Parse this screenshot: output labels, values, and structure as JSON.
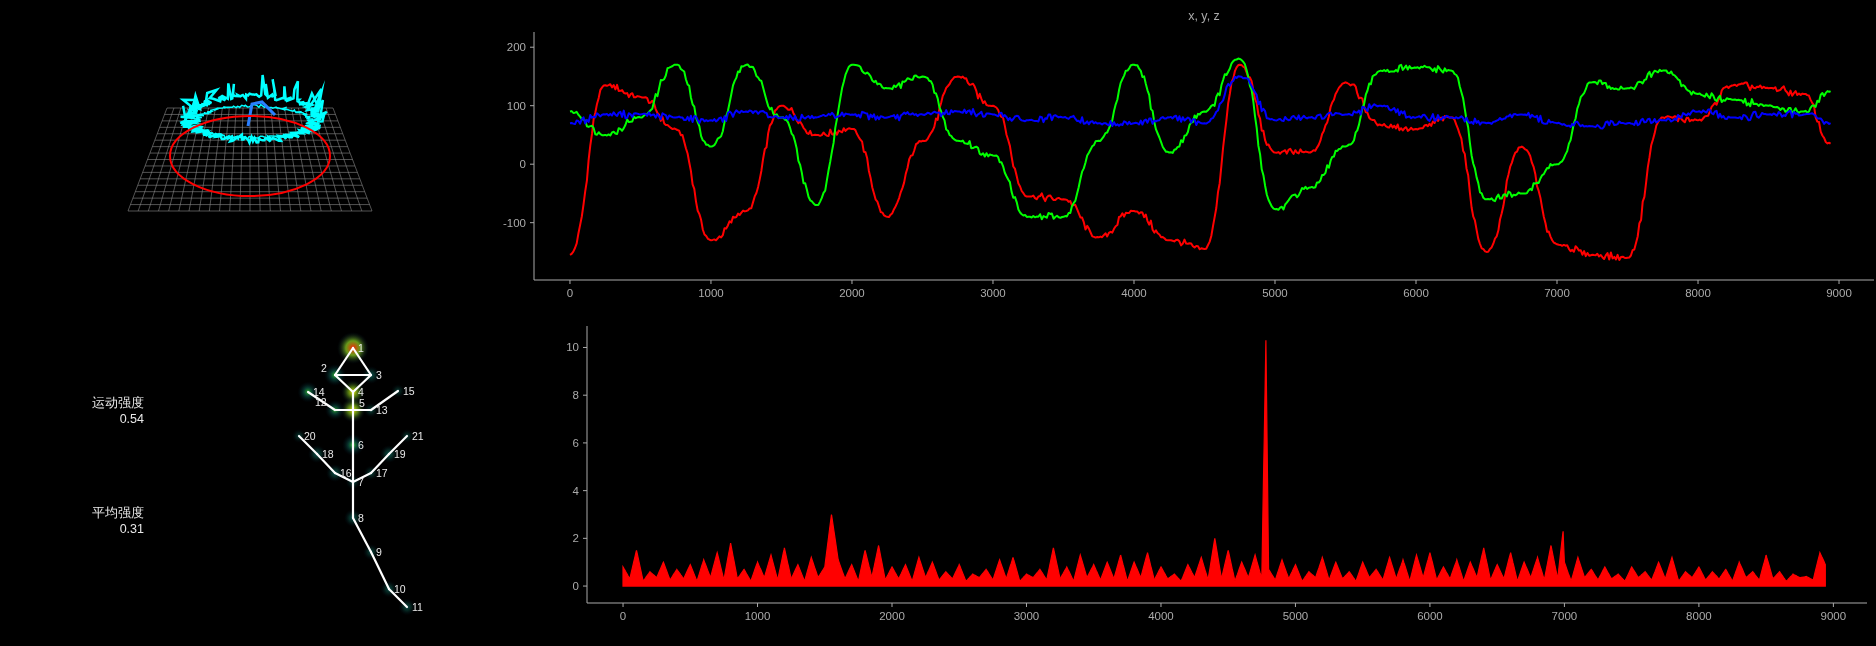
{
  "metrics": [
    {
      "label": "运动强度",
      "value": "0.54"
    },
    {
      "label": "平均强度",
      "value": "0.31"
    }
  ],
  "skeleton": {
    "joints": [
      {
        "label": "1"
      },
      {
        "label": "2"
      },
      {
        "label": "3"
      },
      {
        "label": "4"
      },
      {
        "label": "5"
      },
      {
        "label": "6"
      },
      {
        "label": "7"
      },
      {
        "label": "8"
      },
      {
        "label": "9"
      },
      {
        "label": "10"
      },
      {
        "label": "11"
      },
      {
        "label": "12"
      },
      {
        "label": "13"
      },
      {
        "label": "14"
      },
      {
        "label": "15"
      },
      {
        "label": "16"
      },
      {
        "label": "17"
      },
      {
        "label": "18"
      },
      {
        "label": "19"
      },
      {
        "label": "20"
      },
      {
        "label": "21"
      }
    ]
  },
  "position_chart": {
    "chart_data": {
      "type": "line",
      "title": "x, y, z",
      "x": [
        0,
        250,
        500,
        750,
        1000,
        1250,
        1500,
        1750,
        2000,
        2250,
        2500,
        2750,
        3000,
        3250,
        3500,
        3750,
        4000,
        4250,
        4500,
        4750,
        5000,
        5250,
        5500,
        5750,
        6000,
        6250,
        6500,
        6750,
        7000,
        7250,
        7500,
        7750,
        8000,
        8250,
        8500,
        8750,
        8940
      ],
      "series": [
        {
          "color": "#ff0000",
          "values": [
            -155,
            135,
            115,
            60,
            -130,
            -80,
            100,
            50,
            60,
            -90,
            40,
            150,
            100,
            -55,
            -60,
            -125,
            -80,
            -130,
            -145,
            170,
            20,
            20,
            140,
            67,
            60,
            80,
            -150,
            30,
            -137,
            -155,
            -160,
            80,
            75,
            135,
            130,
            120,
            35
          ]
        },
        {
          "color": "#00ff00",
          "values": [
            90,
            50,
            80,
            170,
            30,
            170,
            80,
            -70,
            170,
            130,
            150,
            40,
            15,
            -90,
            -90,
            40,
            170,
            20,
            90,
            180,
            -77,
            -40,
            30,
            160,
            165,
            160,
            -60,
            -50,
            0,
            140,
            130,
            160,
            120,
            110,
            100,
            90,
            125
          ]
        },
        {
          "color": "#0000ff",
          "values": [
            70,
            85,
            85,
            80,
            75,
            90,
            80,
            80,
            85,
            80,
            85,
            90,
            85,
            75,
            80,
            70,
            70,
            80,
            70,
            150,
            75,
            80,
            85,
            100,
            80,
            80,
            70,
            85,
            70,
            65,
            70,
            75,
            90,
            80,
            85,
            85,
            70
          ]
        }
      ],
      "xlim": [
        -255,
        9248
      ],
      "ylim": [
        -198,
        226
      ],
      "xticks": [
        0,
        1000,
        2000,
        3000,
        4000,
        5000,
        6000,
        7000,
        8000,
        9000
      ],
      "yticks": [
        -100,
        0,
        100,
        200
      ]
    }
  },
  "intensity_chart": {
    "chart_data": {
      "type": "area",
      "x": [
        0,
        50,
        100,
        150,
        200,
        250,
        300,
        350,
        400,
        450,
        500,
        550,
        600,
        650,
        700,
        750,
        800,
        850,
        900,
        950,
        1000,
        1050,
        1100,
        1150,
        1200,
        1250,
        1300,
        1350,
        1400,
        1450,
        1500,
        1550,
        1600,
        1650,
        1700,
        1750,
        1800,
        1850,
        1900,
        1950,
        2000,
        2050,
        2100,
        2150,
        2200,
        2250,
        2300,
        2350,
        2400,
        2450,
        2500,
        2550,
        2600,
        2650,
        2700,
        2750,
        2800,
        2850,
        2900,
        2950,
        3000,
        3050,
        3100,
        3150,
        3200,
        3250,
        3300,
        3350,
        3400,
        3450,
        3500,
        3550,
        3600,
        3650,
        3700,
        3750,
        3800,
        3850,
        3900,
        3950,
        4000,
        4050,
        4100,
        4150,
        4200,
        4250,
        4300,
        4350,
        4400,
        4450,
        4500,
        4550,
        4600,
        4650,
        4700,
        4750,
        4780,
        4800,
        4850,
        4900,
        4950,
        5000,
        5050,
        5100,
        5150,
        5200,
        5250,
        5300,
        5350,
        5400,
        5450,
        5500,
        5550,
        5600,
        5650,
        5700,
        5750,
        5800,
        5850,
        5900,
        5950,
        6000,
        6050,
        6100,
        6150,
        6200,
        6250,
        6300,
        6350,
        6400,
        6450,
        6500,
        6550,
        6600,
        6650,
        6700,
        6750,
        6800,
        6850,
        6900,
        6950,
        6990,
        7000,
        7050,
        7100,
        7150,
        7200,
        7250,
        7300,
        7350,
        7400,
        7450,
        7500,
        7550,
        7600,
        7650,
        7700,
        7750,
        7800,
        7850,
        7900,
        7950,
        8000,
        8050,
        8100,
        8150,
        8200,
        8250,
        8300,
        8350,
        8400,
        8450,
        8500,
        8550,
        8600,
        8650,
        8700,
        8750,
        8800,
        8850,
        8900,
        8940
      ],
      "series": [
        {
          "color": "#ff0000",
          "values": [
            0.8,
            0.3,
            1.5,
            0.2,
            0.6,
            0.35,
            1.0,
            0.25,
            0.7,
            0.3,
            0.9,
            0.2,
            1.1,
            0.35,
            1.4,
            0.25,
            1.8,
            0.3,
            0.7,
            0.2,
            1.0,
            0.35,
            1.3,
            0.25,
            1.6,
            0.3,
            0.9,
            0.2,
            1.2,
            0.35,
            0.8,
            3.0,
            1.1,
            0.3,
            0.9,
            0.2,
            1.5,
            0.35,
            1.7,
            0.25,
            0.8,
            0.3,
            0.9,
            0.2,
            1.2,
            0.35,
            1.0,
            0.25,
            0.6,
            0.3,
            0.9,
            0.2,
            0.5,
            0.35,
            0.7,
            0.25,
            1.1,
            0.3,
            1.2,
            0.2,
            0.5,
            0.35,
            0.7,
            0.25,
            1.6,
            0.3,
            0.8,
            0.2,
            1.3,
            0.35,
            0.9,
            0.25,
            1.0,
            0.3,
            1.3,
            0.2,
            1.0,
            0.35,
            1.4,
            0.25,
            0.8,
            0.3,
            0.5,
            0.2,
            0.9,
            0.35,
            1.2,
            0.25,
            2.0,
            0.3,
            1.5,
            0.2,
            1.0,
            0.35,
            1.3,
            0.3,
            10.3,
            0.7,
            0.25,
            1.1,
            0.3,
            0.9,
            0.2,
            0.6,
            0.35,
            1.2,
            0.25,
            1.0,
            0.3,
            0.6,
            0.2,
            1.0,
            0.35,
            0.7,
            0.25,
            1.2,
            0.3,
            1.1,
            0.2,
            1.3,
            0.35,
            1.4,
            0.25,
            0.8,
            0.3,
            1.1,
            0.2,
            1.0,
            0.35,
            1.6,
            0.25,
            0.9,
            0.3,
            1.4,
            0.2,
            1.0,
            0.35,
            1.2,
            0.25,
            1.7,
            0.3,
            2.3,
            1.0,
            0.2,
            1.2,
            0.35,
            0.7,
            0.25,
            0.8,
            0.3,
            0.5,
            0.2,
            0.8,
            0.35,
            0.6,
            0.25,
            1.0,
            0.3,
            1.2,
            0.2,
            0.6,
            0.35,
            0.8,
            0.25,
            0.6,
            0.3,
            0.7,
            0.2,
            1.0,
            0.35,
            0.6,
            0.25,
            1.3,
            0.3,
            0.6,
            0.2,
            0.5,
            0.35,
            0.4,
            0.25,
            1.4,
            0.9
          ]
        }
      ],
      "xlim": [
        -268,
        9250
      ],
      "ylim": [
        -0.71,
        10.9
      ],
      "xticks": [
        0,
        1000,
        2000,
        3000,
        4000,
        5000,
        6000,
        7000,
        8000,
        9000
      ],
      "yticks": [
        0,
        2,
        4,
        6,
        8,
        10
      ]
    }
  }
}
